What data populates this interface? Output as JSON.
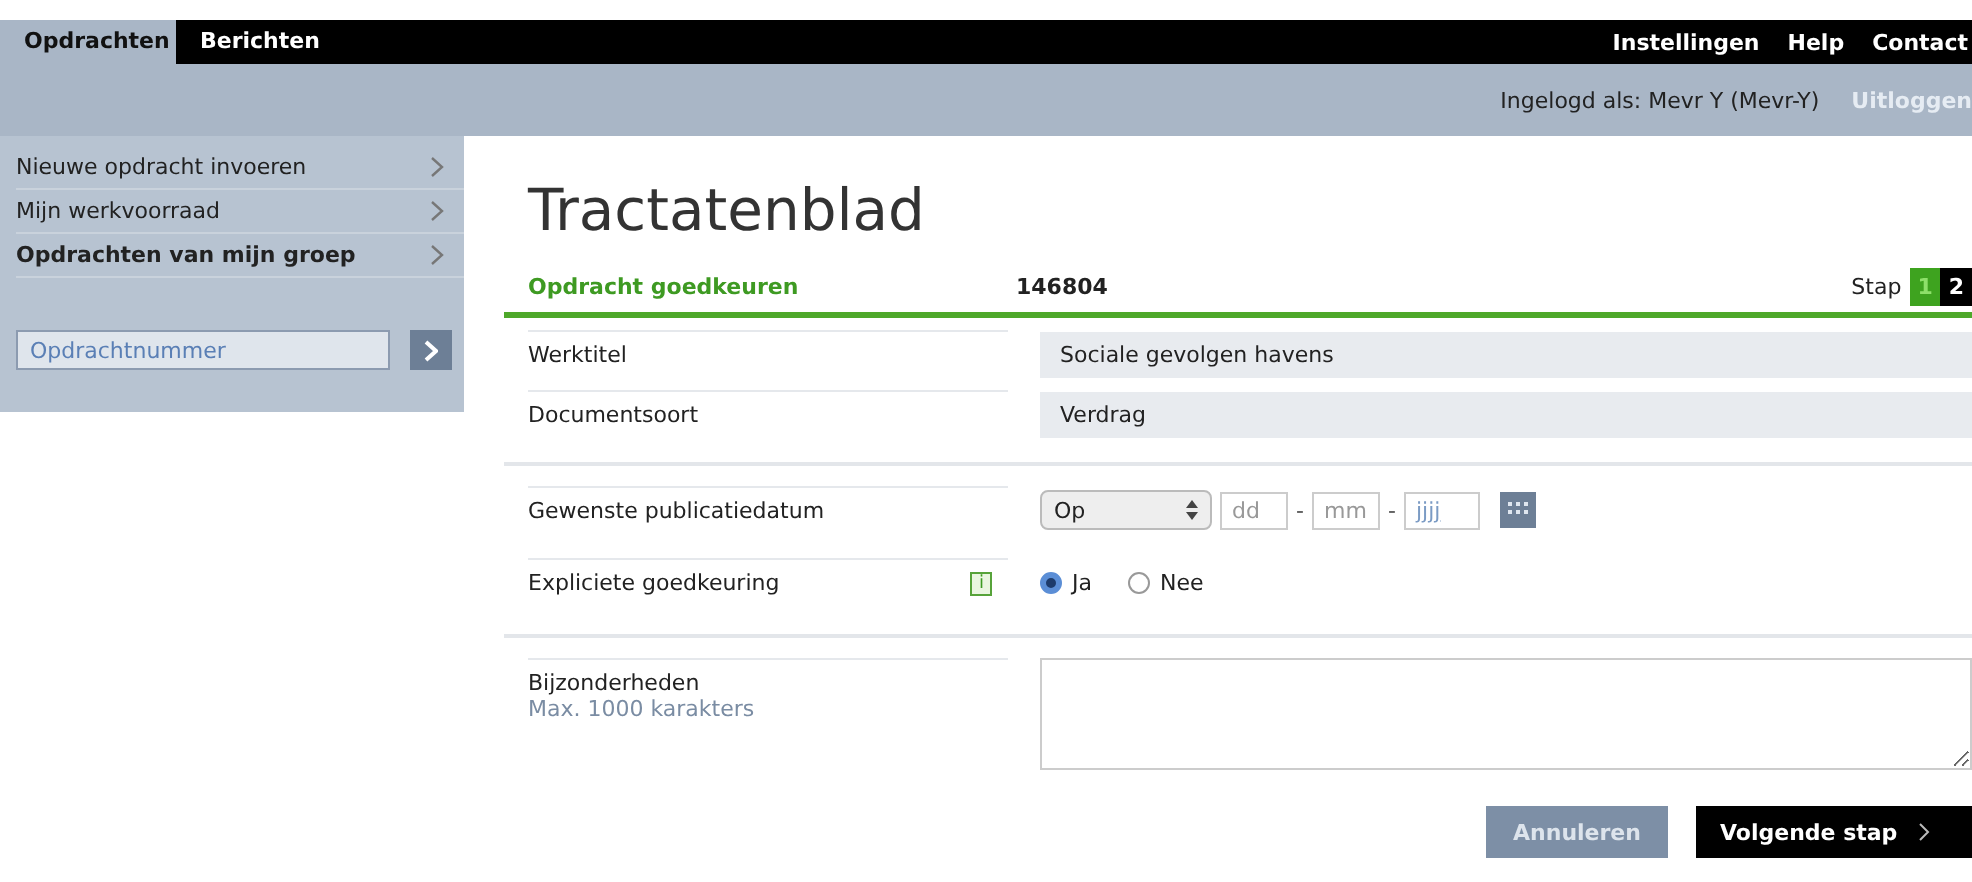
{
  "tabs": [
    {
      "label": "Opdrachten",
      "selected": true
    },
    {
      "label": "Berichten",
      "selected": false
    }
  ],
  "top_links": [
    "Instellingen",
    "Help",
    "Contact"
  ],
  "login": {
    "text": "Ingelogd als: Mevr Y (Mevr-Y)",
    "logout": "Uitloggen"
  },
  "sidebar": {
    "items": [
      {
        "label": "Nieuwe opdracht invoeren",
        "selected": false
      },
      {
        "label": "Mijn werkvoorraad",
        "selected": false
      },
      {
        "label": "Opdrachten van mijn groep",
        "selected": true
      }
    ],
    "search": {
      "value": "Opdrachtnummer"
    }
  },
  "page_title": "Tractatenblad",
  "section": {
    "title": "Opdracht goedkeuren",
    "number": "146804",
    "step_label": "Stap",
    "steps": [
      {
        "label": "1",
        "selected": true
      },
      {
        "label": "2",
        "selected": false
      }
    ]
  },
  "fields": [
    {
      "kind": "readonly",
      "label": "Werktitel",
      "value": "Sociale gevolgen havens"
    },
    {
      "kind": "readonly",
      "label": "Documentsoort",
      "value": "Verdrag"
    },
    {
      "kind": "date",
      "label": "Gewenste publicatiedatum",
      "select": "Op",
      "day": "dd",
      "month": "mm",
      "year": "jjjj",
      "separators": [
        "-",
        "-"
      ]
    },
    {
      "kind": "radio",
      "label": "Expliciete goedkeuring",
      "info": "i",
      "options": [
        {
          "label": "Ja",
          "selected": true
        },
        {
          "label": "Nee",
          "selected": false
        }
      ]
    },
    {
      "kind": "textarea",
      "label": "Bijzonderheden",
      "hint": "Max. 1000 karakters"
    }
  ],
  "buttons": [
    {
      "label": "Annuleren",
      "kind": "secondary"
    },
    {
      "label": "Volgende stap",
      "kind": "primary"
    }
  ]
}
